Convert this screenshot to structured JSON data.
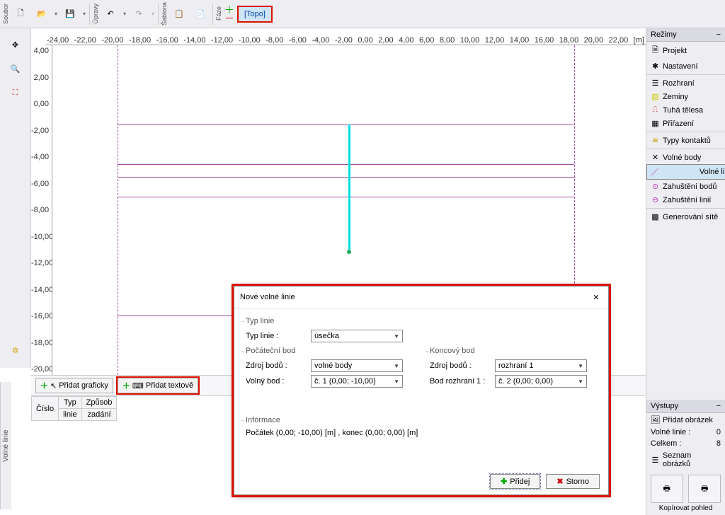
{
  "toolbar": {
    "file_label": "Soubor",
    "edit_label": "Úpravy",
    "template_label": "Šablona",
    "phase_label": "Fáze",
    "topo_label": "[Topo]"
  },
  "canvas": {
    "x_ticks": [
      "-24,00",
      "-22,00",
      "-20,00",
      "-18,00",
      "-16,00",
      "-14,00",
      "-12,00",
      "-10,00",
      "-8,00",
      "-6,00",
      "-4,00",
      "-2,00",
      "0,00",
      "2,00",
      "4,00",
      "6,00",
      "8,00",
      "10,00",
      "12,00",
      "14,00",
      "16,00",
      "18,00",
      "20,00",
      "22,00"
    ],
    "x_unit": "[m]",
    "y_ticks": [
      "4,00",
      "2,00",
      "0,00",
      "-2,00",
      "-4,00",
      "-6,00",
      "-8,00",
      "-10,00",
      "-12,00",
      "-14,00",
      "-16,00",
      "-18,00",
      "-20,00"
    ]
  },
  "bottom": {
    "add_graphic": "Přidat graficky",
    "add_text": "Přidat textově"
  },
  "table": {
    "h_num": "Číslo",
    "h_type_top": "Typ",
    "h_type_bot": "linie",
    "h_mode_top": "Způsob",
    "h_mode_bot": "zadání"
  },
  "side_caption": "Volné linie",
  "modes": {
    "title": "Režimy",
    "project": "Projekt",
    "settings": "Nastavení",
    "interface": "Rozhraní",
    "soils": "Zeminy",
    "rigid": "Tuhá tělesa",
    "assign": "Přiřazení",
    "contacts": "Typy kontaktů",
    "free_pts": "Volné body",
    "free_lines": "Volné linie",
    "refine_pts": "Zahuštění bodů",
    "refine_lines": "Zahuštění linií",
    "mesh": "Generování sítě"
  },
  "outputs": {
    "title": "Výstupy",
    "add_pic": "Přidat obrázek",
    "free_lines_lbl": "Volné linie :",
    "free_lines_val": "0",
    "total_lbl": "Celkem :",
    "total_val": "8",
    "list_pics": "Seznam obrázků",
    "copy_view": "Kopírovat pohled"
  },
  "dialog": {
    "title": "Nové volné linie",
    "sec_type": "Typ linie",
    "type_lbl": "Typ linie :",
    "type_val": "úsečka",
    "sec_start": "Počáteční bod",
    "sec_end": "Koncový bod",
    "src_lbl": "Zdroj bodů :",
    "start_src": "volné body",
    "end_src": "rozhraní 1",
    "start_pt_lbl": "Volný bod :",
    "start_pt_val": "č.  1 (0,00; -10,00)",
    "end_pt_lbl": "Bod rozhraní 1 :",
    "end_pt_val": "č.  2 (0,00; 0,00)",
    "sec_info": "Informace",
    "info_text": "Počátek (0,00; -10,00) [m] ,  konec (0,00; 0,00) [m]",
    "ok": "Přidej",
    "cancel": "Storno"
  }
}
